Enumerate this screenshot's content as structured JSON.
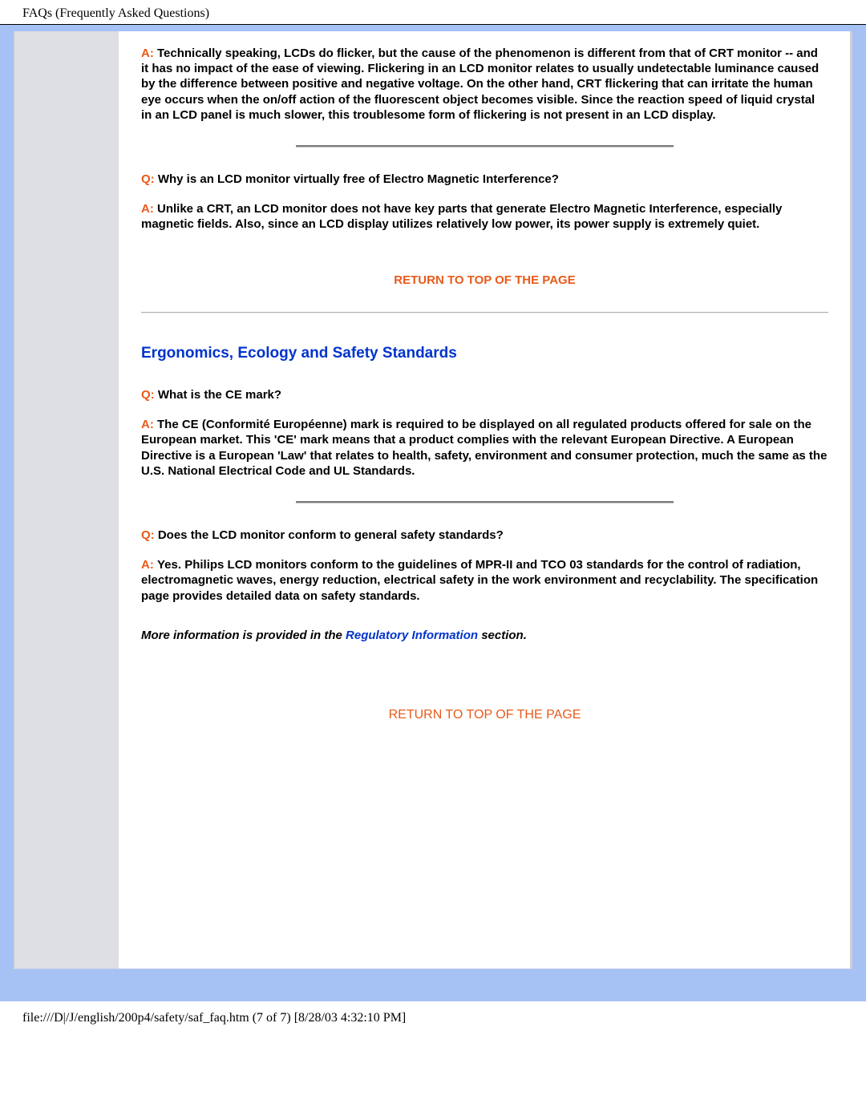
{
  "header": {
    "title": "FAQs (Frequently Asked Questions)"
  },
  "labels": {
    "q": "Q:",
    "a": "A:"
  },
  "qa1": {
    "answer": "Technically speaking, LCDs do flicker, but the cause of the phenomenon is different from that of CRT monitor -- and it has no impact of the ease of viewing. Flickering in an LCD monitor relates to usually undetectable luminance caused by the difference between positive and negative voltage. On the other hand, CRT flickering that can irritate the human eye occurs when the on/off action of the fluorescent object becomes visible. Since the reaction speed of liquid crystal in an LCD panel is much slower, this troublesome form of flickering is not present in an LCD display."
  },
  "qa2": {
    "question": "Why is an LCD monitor virtually free of Electro Magnetic Interference?",
    "answer": "Unlike a CRT, an LCD monitor does not have key parts that generate Electro Magnetic Interference, especially magnetic fields. Also, since an LCD display utilizes relatively low power, its power supply is extremely quiet."
  },
  "return_link_bold": "RETURN TO TOP OF THE PAGE",
  "section_heading": "Ergonomics, Ecology and Safety Standards",
  "qa3": {
    "question": "What is the CE mark?",
    "answer": "The CE (Conformité Européenne) mark is required to be displayed on all regulated products offered for sale on the European market. This 'CE' mark means that a product complies with the relevant European Directive. A European Directive is a European 'Law' that relates to health, safety, environment and consumer protection, much the same as the U.S. National Electrical Code and UL Standards."
  },
  "qa4": {
    "question": "Does the LCD monitor conform to general safety standards?",
    "answer": "Yes. Philips LCD monitors conform to the guidelines of MPR-II and TCO 03 standards for the control of radiation, electromagnetic waves, energy reduction, electrical safety in the work environment and recyclability. The specification page provides detailed data on safety standards."
  },
  "more_info": {
    "prefix": "More information is provided in the ",
    "link": "Regulatory Information",
    "suffix": " section."
  },
  "return_link_plain": "RETURN TO TOP OF THE PAGE",
  "footer": {
    "path": "file:///D|/J/english/200p4/safety/saf_faq.htm (7 of 7) [8/28/03 4:32:10 PM]"
  }
}
